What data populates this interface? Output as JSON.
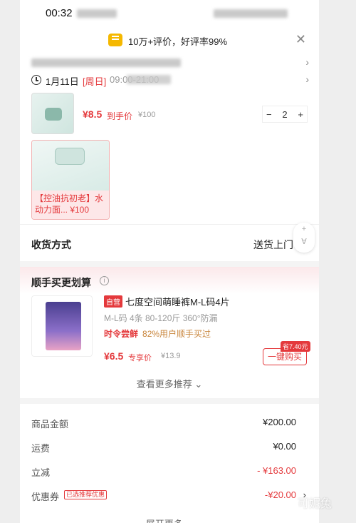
{
  "status_bar": {
    "time": "00:32"
  },
  "rating_banner": {
    "text": "10万+评价，好评率99%",
    "close": "✕"
  },
  "delivery_time": {
    "date": "1月11日",
    "weekday": "[周日]",
    "time_range": "09:00-21:00"
  },
  "product": {
    "price": "¥8.5",
    "price_tag": "到手价",
    "original_price": "¥100",
    "quantity": "2",
    "minus": "−",
    "plus": "+"
  },
  "gift": {
    "caption": "【控油抗初老】水动力面... ¥100"
  },
  "delivery_method": {
    "label": "收货方式",
    "value": "送货上门",
    "chevron": "›"
  },
  "float_button": {
    "top": "+",
    "bottom": "∀"
  },
  "recommend": {
    "title": "顺手买更划算",
    "info": "i",
    "item": {
      "self_tag": "自营",
      "name": "七度空间萌睡裤M-L码4片",
      "spec": "M-L码 4条 80-120斤 360°防漏",
      "promo_label": "时令尝鲜",
      "promo_text": "82%用户顺手买过",
      "price": "¥6.5",
      "price_tag": "专享价",
      "original_price": "¥13.9",
      "save_badge": "省7.40元",
      "buy_button": "一键购买"
    },
    "more": "查看更多推荐 ⌄"
  },
  "totals": {
    "goods_label": "商品金额",
    "goods_value": "¥200.00",
    "shipping_label": "运费",
    "shipping_value": "¥0.00",
    "discount_label": "立减",
    "discount_value": "- ¥163.00",
    "coupon_label": "优惠券",
    "coupon_tag": "已选推荐优惠",
    "coupon_value": "-¥20.00",
    "expand": "展开更多 ⌄"
  },
  "watermark": "可妮兔",
  "colors": {
    "accent_red": "#e4393c",
    "promo_gold": "#c8843a",
    "rating_yellow": "#f5b800"
  }
}
